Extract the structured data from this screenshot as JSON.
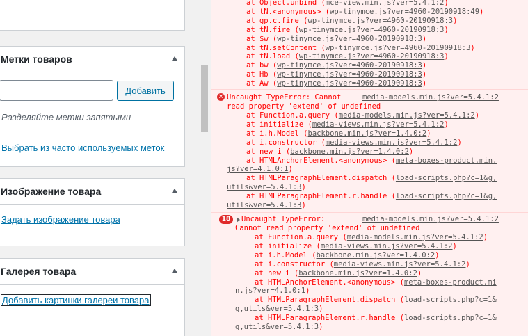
{
  "tags_box": {
    "title": "Метки товаров",
    "add_label": "Добавить",
    "hint": "Разделяйте метки запятыми",
    "choose_link": "Выбрать из часто используемых меток"
  },
  "image_box": {
    "title": "Изображение товара",
    "set_link": "Задать изображение товара"
  },
  "gallery_box": {
    "title": "Галерея товара",
    "add_link": "Добавить картинки галереи товара"
  },
  "console": {
    "top_trace": [
      {
        "fn": "at Object.unbind (",
        "src": "mce-view.min.js?ver=5.4.1:2",
        "end": ")"
      },
      {
        "fn": "at tN.<anonymous> (",
        "src": "wp-tinymce.js?ver=4960-20190918:49",
        "end": ")"
      },
      {
        "fn": "at gp.c.fire (",
        "src": "wp-tinymce.js?ver=4960-20190918:3",
        "end": ")"
      },
      {
        "fn": "at tN.fire (",
        "src": "wp-tinymce.js?ver=4960-20190918:3",
        "end": ")"
      },
      {
        "fn": "at $w (",
        "src": "wp-tinymce.js?ver=4960-20190918:3",
        "end": ")"
      },
      {
        "fn": "at tN.setContent (",
        "src": "wp-tinymce.js?ver=4960-20190918:3",
        "end": ")"
      },
      {
        "fn": "at tN.load (",
        "src": "wp-tinymce.js?ver=4960-20190918:3",
        "end": ")"
      },
      {
        "fn": "at bw (",
        "src": "wp-tinymce.js?ver=4960-20190918:3",
        "end": ")"
      },
      {
        "fn": "at Hb (",
        "src": "wp-tinymce.js?ver=4960-20190918:3",
        "end": ")"
      },
      {
        "fn": "at Aw (",
        "src": "wp-tinymce.js?ver=4960-20190918:3",
        "end": ")"
      }
    ],
    "error1": {
      "line1": "Uncaught TypeError: Cannot",
      "source": "media-models.min.js?ver=5.4.1:2",
      "line2": "read property 'extend' of undefined",
      "trace": [
        {
          "fn": "at Function.a.query (",
          "src": "media-models.min.js?ver=5.4.1:2",
          "end": ")"
        },
        {
          "fn": "at initialize (",
          "src": "media-views.min.js?ver=5.4.1:2",
          "end": ")"
        },
        {
          "fn": "at i.h.Model (",
          "src": "backbone.min.js?ver=1.4.0:2",
          "end": ")"
        },
        {
          "fn": "at i.constructor (",
          "src": "media-views.min.js?ver=5.4.1:2",
          "end": ")"
        },
        {
          "fn": "at new i (",
          "src": "backbone.min.js?ver=1.4.0:2",
          "end": ")"
        },
        {
          "fn": "at HTMLAnchorElement.<anonymous> (",
          "src": "meta-boxes-product.min.",
          "end": ""
        },
        {
          "fn": "",
          "src": "js?ver=4.1.0:1",
          "end": ")"
        },
        {
          "fn": "at HTMLParagraphElement.dispatch (",
          "src": "load-scripts.php?c=1&g,",
          "end": ""
        },
        {
          "fn": "",
          "src": "utils&ver=5.4.1:3",
          "end": ")"
        },
        {
          "fn": "at HTMLParagraphElement.r.handle (",
          "src": "load-scripts.php?c=1&g,",
          "end": ""
        },
        {
          "fn": "",
          "src": "utils&ver=5.4.1:3",
          "end": ")"
        }
      ]
    },
    "error2": {
      "count": "18",
      "line1": "Uncaught TypeError:",
      "source": "media-models.min.js?ver=5.4.1:2",
      "line2": "Cannot read property 'extend' of undefined",
      "trace": [
        {
          "fn": "at Function.a.query (",
          "src": "media-models.min.js?ver=5.4.1:2",
          "end": ")"
        },
        {
          "fn": "at initialize (",
          "src": "media-views.min.js?ver=5.4.1:2",
          "end": ")"
        },
        {
          "fn": "at i.h.Model (",
          "src": "backbone.min.js?ver=1.4.0:2",
          "end": ")"
        },
        {
          "fn": "at i.constructor (",
          "src": "media-views.min.js?ver=5.4.1:2",
          "end": ")"
        },
        {
          "fn": "at new i (",
          "src": "backbone.min.js?ver=1.4.0:2",
          "end": ")"
        },
        {
          "fn": "at HTMLAnchorElement.<anonymous> (",
          "src": "meta-boxes-product.mi",
          "end": ""
        },
        {
          "fn": "",
          "src": "n.js?ver=4.1.0:1",
          "end": ")"
        },
        {
          "fn": "at HTMLParagraphElement.dispatch (",
          "src": "load-scripts.php?c=1&",
          "end": ""
        },
        {
          "fn": "",
          "src": "g,utils&ver=5.4.1:3",
          "end": ")"
        },
        {
          "fn": "at HTMLParagraphElement.r.handle (",
          "src": "load-scripts.php?c=1&",
          "end": ""
        },
        {
          "fn": "",
          "src": "g,utils&ver=5.4.1:3",
          "end": ")"
        }
      ]
    }
  }
}
